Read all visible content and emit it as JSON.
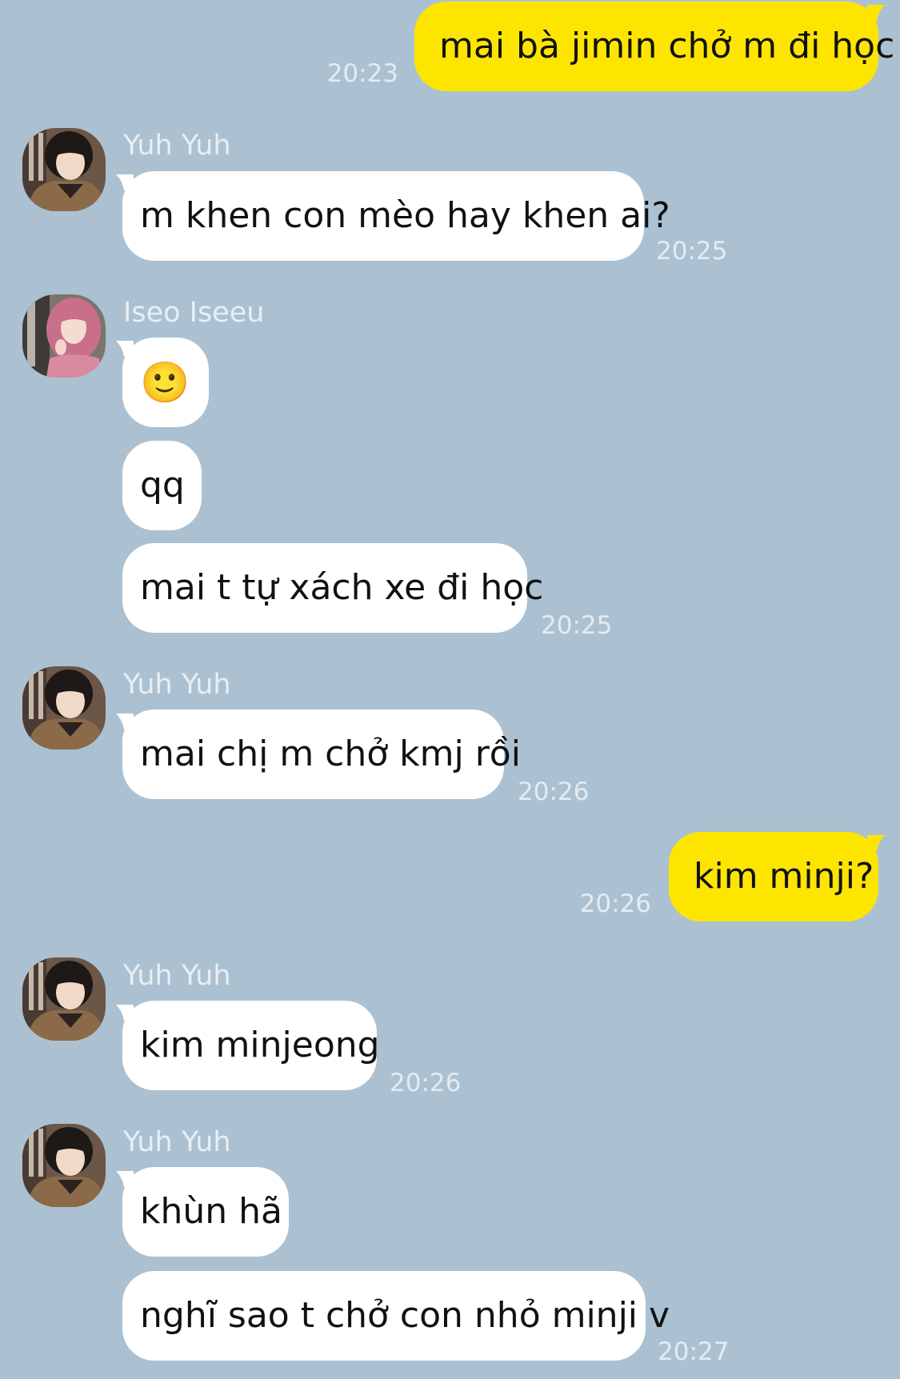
{
  "colors": {
    "background": "#abc1d1",
    "incoming_bubble": "#ffffff",
    "outgoing_bubble": "#fee500",
    "meta_text": "#e8eef3"
  },
  "chat": {
    "messages": [
      {
        "from": "me",
        "text": "mai bà jimin chở m đi học",
        "time": "20:23"
      },
      {
        "from": "Yuh Yuh",
        "sender": "Yuh Yuh",
        "text": "m khen con mèo hay khen ai?",
        "time": "20:25"
      },
      {
        "from": "Iseo Iseeu",
        "sender": "Iseo Iseeu",
        "text": "🙂"
      },
      {
        "from": "Iseo Iseeu",
        "text": "qq"
      },
      {
        "from": "Iseo Iseeu",
        "text": "mai t tự xách xe đi học",
        "time": "20:25"
      },
      {
        "from": "Yuh Yuh",
        "sender": "Yuh Yuh",
        "text": "mai chị m chở kmj rồi",
        "time": "20:26"
      },
      {
        "from": "me",
        "text": "kim minji?",
        "time": "20:26"
      },
      {
        "from": "Yuh Yuh",
        "sender": "Yuh Yuh",
        "text": "kim minjeong",
        "time": "20:26"
      },
      {
        "from": "Yuh Yuh",
        "sender": "Yuh Yuh",
        "text": "khùn hã"
      },
      {
        "from": "Yuh Yuh",
        "text": "nghĩ sao t chở con nhỏ minji v",
        "time": "20:27"
      }
    ],
    "avatars": {
      "yuh_yuh": "avatar-photo-dark-hair",
      "iseo_iseeu": "avatar-photo-pink-hair"
    }
  }
}
